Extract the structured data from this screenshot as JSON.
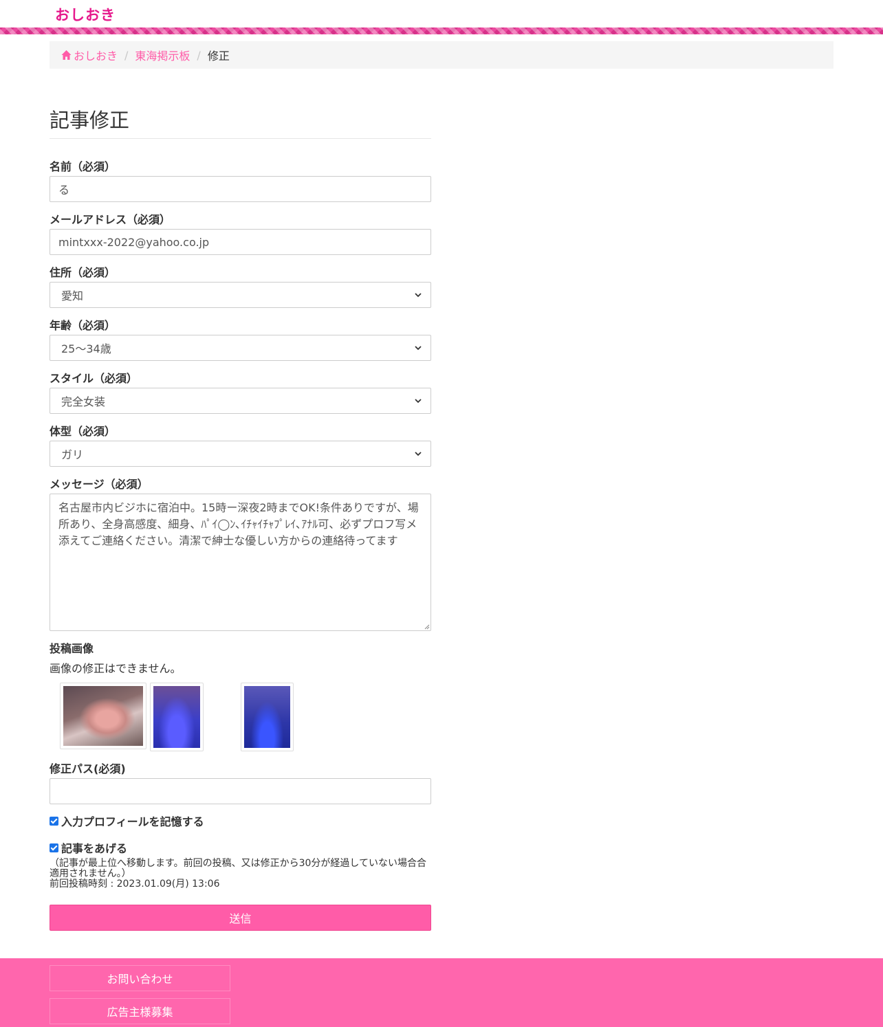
{
  "site": {
    "logo": "おしおき"
  },
  "breadcrumb": {
    "home": "おしおき",
    "board": "東海掲示板",
    "current": "修正"
  },
  "page_title": "記事修正",
  "form": {
    "name_label": "名前（必須）",
    "name_value": "る",
    "email_label": "メールアドレス（必須）",
    "email_value": "mintxxx-2022@yahoo.co.jp",
    "address_label": "住所（必須）",
    "address_value": "愛知",
    "age_label": "年齢（必須）",
    "age_value": "25〜34歳",
    "style_label": "スタイル（必須）",
    "style_value": "完全女装",
    "body_label": "体型（必須）",
    "body_value": "ガリ",
    "message_label": "メッセージ（必須）",
    "message_value": "名古屋市内ビジホに宿泊中。15時ー深夜2時までOK!条件ありですが、場所あり、全身高感度、細身、ﾊﾟｲ◯ﾝ､ｲﾁｬｲﾁｬﾌﾟﾚｲ､ｱﾅﾙ可、必ずプロフ写メ添えてご連絡ください。清潔で紳士な優しい方からの連絡待ってます",
    "images_label": "投稿画像",
    "images_note": "画像の修正はできません。",
    "pass_label": "修正パス(必須)",
    "pass_value": "",
    "remember_label": "入力プロフィールを記憶する",
    "bump_label": "記事をあげる",
    "bump_note": "（記事が最上位へ移動します。前回の投稿、又は修正から30分が経過していない場合合適用されません。）",
    "last_post": "前回投稿時刻 : 2023.01.09(月) 13:06",
    "submit_label": "送信"
  },
  "footer": {
    "contact": "お問い合わせ",
    "ads": "広告主様募集"
  },
  "colors": {
    "brand": "#e6198c",
    "accent": "#ff5ca8",
    "footer": "#ff66ad"
  }
}
